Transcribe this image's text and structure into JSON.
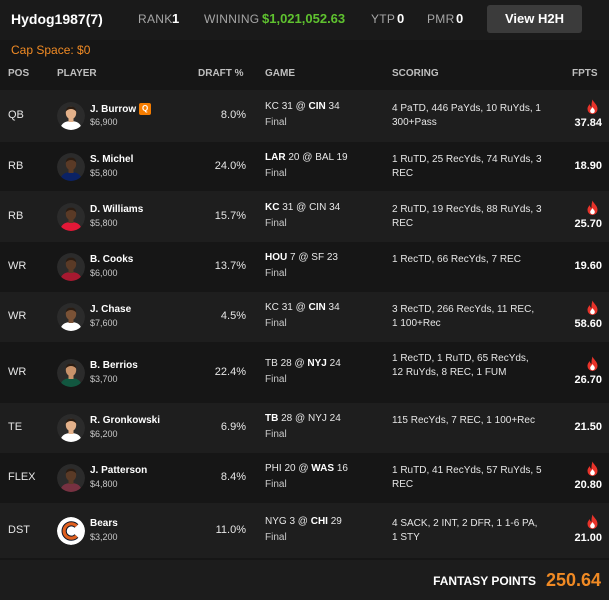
{
  "header": {
    "username": "Hydog1987",
    "entry_count": "(7)",
    "rank_label": "RANK",
    "rank_value": "1",
    "winning_label": "WINNING",
    "winning_value": "$1,021,052.63",
    "ytp_label": "YTP",
    "ytp_value": "0",
    "pmr_label": "PMR",
    "pmr_value": "0",
    "h2h_button": "View H2H"
  },
  "cap_space": "Cap Space: $0",
  "columns": {
    "pos": "POS",
    "player": "PLAYER",
    "draft": "DRAFT %",
    "game": "GAME",
    "scoring": "SCORING",
    "fpts": "FPTS"
  },
  "colors": {
    "accent_orange": "#f08a24",
    "winning_green": "#5fc22f",
    "fire_red": "#e8332a"
  },
  "roster": [
    {
      "pos": "QB",
      "name": "J. Burrow",
      "badge": "Q",
      "salary": "$6,900",
      "draft": "8.0%",
      "g_away": "KC",
      "g_away_score": "31",
      "g_sep": "@",
      "g_home": "CIN",
      "g_home_score": "34",
      "g_bold": "home",
      "status": "Final",
      "scoring": "4 PaTD, 446 PaYds, 10 RuYds, 1 300+Pass",
      "fpts": "37.84",
      "hot": true,
      "jersey": "#ffffff",
      "skin": "#e3b18a"
    },
    {
      "pos": "RB",
      "name": "S. Michel",
      "badge": "",
      "salary": "$5,800",
      "draft": "24.0%",
      "g_away": "LAR",
      "g_away_score": "20",
      "g_sep": "@",
      "g_home": "BAL",
      "g_home_score": "19",
      "g_bold": "away",
      "status": "Final",
      "scoring": "1 RuTD, 25 RecYds, 74 RuYds, 3 REC",
      "fpts": "18.90",
      "hot": false,
      "jersey": "#0b2265",
      "skin": "#5a3a26"
    },
    {
      "pos": "RB",
      "name": "D. Williams",
      "badge": "",
      "salary": "$5,800",
      "draft": "15.7%",
      "g_away": "KC",
      "g_away_score": "31",
      "g_sep": "@",
      "g_home": "CIN",
      "g_home_score": "34",
      "g_bold": "away",
      "status": "Final",
      "scoring": "2 RuTD, 19 RecYds, 88 RuYds, 3 REC",
      "fpts": "25.70",
      "hot": true,
      "jersey": "#e31837",
      "skin": "#5a3a26"
    },
    {
      "pos": "WR",
      "name": "B. Cooks",
      "badge": "",
      "salary": "$6,000",
      "draft": "13.7%",
      "g_away": "HOU",
      "g_away_score": "7",
      "g_sep": "@",
      "g_home": "SF",
      "g_home_score": "23",
      "g_bold": "away",
      "status": "Final",
      "scoring": "1 RecTD, 66 RecYds, 7 REC",
      "fpts": "19.60",
      "hot": false,
      "jersey": "#a71930",
      "skin": "#5a3a26"
    },
    {
      "pos": "WR",
      "name": "J. Chase",
      "badge": "",
      "salary": "$7,600",
      "draft": "4.5%",
      "g_away": "KC",
      "g_away_score": "31",
      "g_sep": "@",
      "g_home": "CIN",
      "g_home_score": "34",
      "g_bold": "home",
      "status": "Final",
      "scoring": "3 RecTD, 266 RecYds, 11 REC, 1 100+Rec",
      "fpts": "58.60",
      "hot": true,
      "jersey": "#ffffff",
      "skin": "#7a5236"
    },
    {
      "pos": "WR",
      "name": "B. Berrios",
      "badge": "",
      "salary": "$3,700",
      "draft": "22.4%",
      "g_away": "TB",
      "g_away_score": "28",
      "g_sep": "@",
      "g_home": "NYJ",
      "g_home_score": "24",
      "g_bold": "home",
      "status": "Final",
      "scoring": "1 RecTD, 1 RuTD, 65 RecYds, 12 RuYds, 8 REC, 1 FUM",
      "fpts": "26.70",
      "hot": true,
      "jersey": "#125740",
      "skin": "#c8926a"
    },
    {
      "pos": "TE",
      "name": "R. Gronkowski",
      "badge": "",
      "salary": "$6,200",
      "draft": "6.9%",
      "g_away": "TB",
      "g_away_score": "28",
      "g_sep": "@",
      "g_home": "NYJ",
      "g_home_score": "24",
      "g_bold": "away",
      "status": "Final",
      "scoring": "115 RecYds, 7 REC, 1 100+Rec",
      "fpts": "21.50",
      "hot": false,
      "jersey": "#ffffff",
      "skin": "#e3b18a"
    },
    {
      "pos": "FLEX",
      "name": "J. Patterson",
      "badge": "",
      "salary": "$4,800",
      "draft": "8.4%",
      "g_away": "PHI",
      "g_away_score": "20",
      "g_sep": "@",
      "g_home": "WAS",
      "g_home_score": "16",
      "g_bold": "home",
      "status": "Final",
      "scoring": "1 RuTD, 41 RecYds, 57 RuYds, 5 REC",
      "fpts": "20.80",
      "hot": true,
      "jersey": "#773141",
      "skin": "#5a3a26"
    },
    {
      "pos": "DST",
      "name": "Bears",
      "badge": "",
      "salary": "$3,200",
      "draft": "11.0%",
      "g_away": "NYG",
      "g_away_score": "3",
      "g_sep": "@",
      "g_home": "CHI",
      "g_home_score": "29",
      "g_bold": "home",
      "status": "Final",
      "scoring": "4 SACK, 2 INT, 2 DFR, 1 1-6 PA, 1 STY",
      "fpts": "21.00",
      "hot": true,
      "logo": "bears-logo"
    }
  ],
  "footer": {
    "label": "FANTASY POINTS",
    "total": "250.64"
  }
}
